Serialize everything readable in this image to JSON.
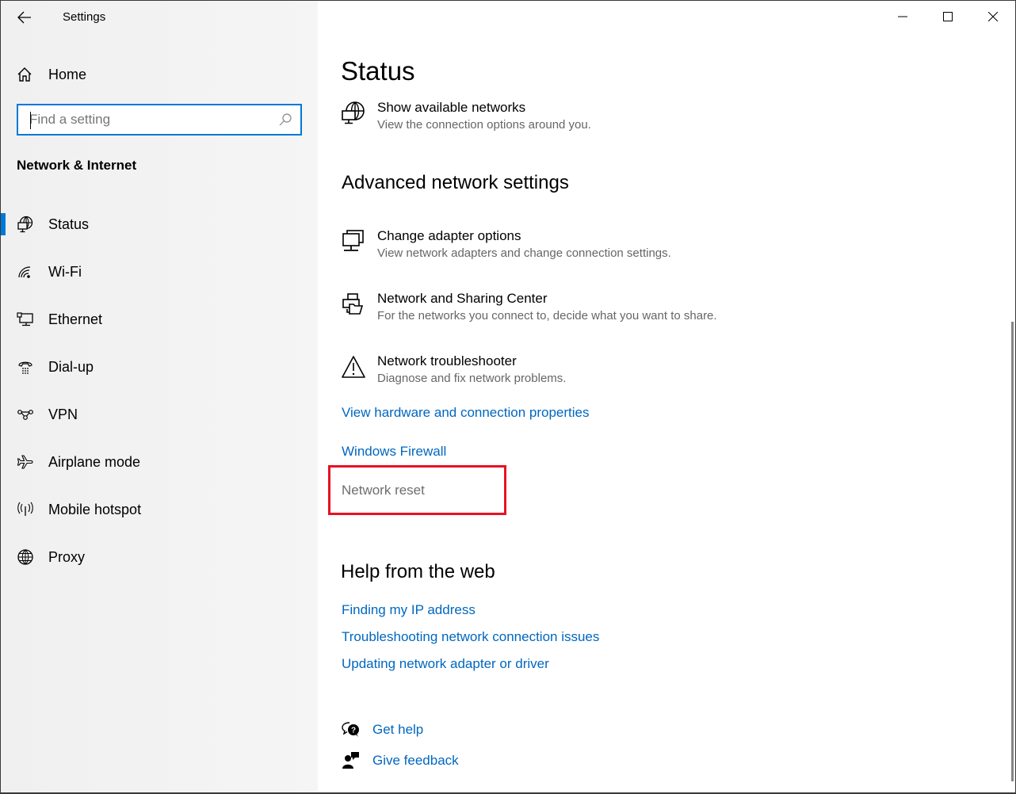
{
  "window": {
    "title": "Settings",
    "controls": {
      "minimize": "minimize-icon",
      "maximize": "maximize-icon",
      "close": "close-icon"
    }
  },
  "sidebar": {
    "back_icon": "back-arrow-icon",
    "home": {
      "label": "Home",
      "icon": "home-icon"
    },
    "search": {
      "placeholder": "Find a setting",
      "value": "",
      "icon": "search-icon"
    },
    "section_title": "Network & Internet",
    "items": [
      {
        "label": "Status",
        "icon": "status-globe-icon",
        "active": true
      },
      {
        "label": "Wi-Fi",
        "icon": "wifi-icon",
        "active": false
      },
      {
        "label": "Ethernet",
        "icon": "ethernet-icon",
        "active": false
      },
      {
        "label": "Dial-up",
        "icon": "dialup-icon",
        "active": false
      },
      {
        "label": "VPN",
        "icon": "vpn-icon",
        "active": false
      },
      {
        "label": "Airplane mode",
        "icon": "airplane-icon",
        "active": false
      },
      {
        "label": "Mobile hotspot",
        "icon": "hotspot-icon",
        "active": false
      },
      {
        "label": "Proxy",
        "icon": "globe-icon",
        "active": false
      }
    ]
  },
  "main": {
    "page_title": "Status",
    "show_networks": {
      "title": "Show available networks",
      "subtitle": "View the connection options around you.",
      "icon": "globe-monitor-icon"
    },
    "advanced": {
      "heading": "Advanced network settings",
      "items": [
        {
          "title": "Change adapter options",
          "subtitle": "View network adapters and change connection settings.",
          "icon": "adapter-icon"
        },
        {
          "title": "Network and Sharing Center",
          "subtitle": "For the networks you connect to, decide what you want to share.",
          "icon": "sharing-center-icon"
        },
        {
          "title": "Network troubleshooter",
          "subtitle": "Diagnose and fix network problems.",
          "icon": "warning-icon"
        }
      ],
      "links": [
        {
          "label": "View hardware and connection properties"
        },
        {
          "label": "Windows Firewall"
        },
        {
          "label": "Network reset",
          "highlighted": true
        }
      ]
    },
    "help": {
      "heading": "Help from the web",
      "links": [
        "Finding my IP address",
        "Troubleshooting network connection issues",
        "Updating network adapter or driver"
      ]
    },
    "footer": {
      "get_help": {
        "label": "Get help",
        "icon": "get-help-icon"
      },
      "give_feedback": {
        "label": "Give feedback",
        "icon": "feedback-icon"
      }
    }
  },
  "colors": {
    "accent": "#0078d7",
    "link": "#0067c0",
    "highlight": "#e81123",
    "secondary_text": "#666666"
  }
}
